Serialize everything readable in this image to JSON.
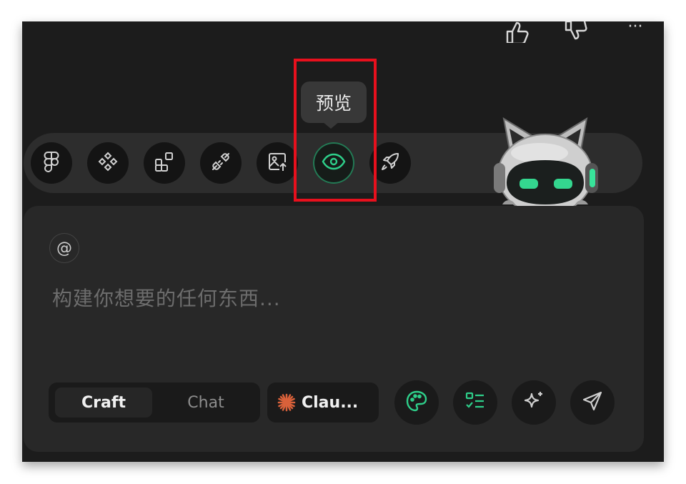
{
  "topbar": {
    "icons": [
      "thumbs-up-icon",
      "thumbs-down-icon",
      "more-icon"
    ],
    "more_label": "···"
  },
  "tooltip": {
    "text": "预览"
  },
  "toolbar": {
    "buttons": [
      {
        "icon": "figma-icon"
      },
      {
        "icon": "components-icon"
      },
      {
        "icon": "blocks-icon"
      },
      {
        "icon": "plug-icon"
      },
      {
        "icon": "image-upload-icon"
      },
      {
        "icon": "eye-icon",
        "active": true
      },
      {
        "icon": "rocket-icon"
      }
    ],
    "active_color": "#2ecf8a"
  },
  "mascot": {
    "icon": "robot-cat-mascot"
  },
  "composer": {
    "mention_label": "@",
    "placeholder": "构建你想要的任何东西...",
    "modes": {
      "craft": "Craft",
      "chat": "Chat"
    },
    "model_label": "Clau...",
    "model_icon": "claude-icon",
    "model_color": "#d9613a",
    "actions": [
      "palette-icon",
      "checklist-icon",
      "sparkle-icon",
      "send-icon"
    ]
  },
  "highlight_color": "#e8101d"
}
